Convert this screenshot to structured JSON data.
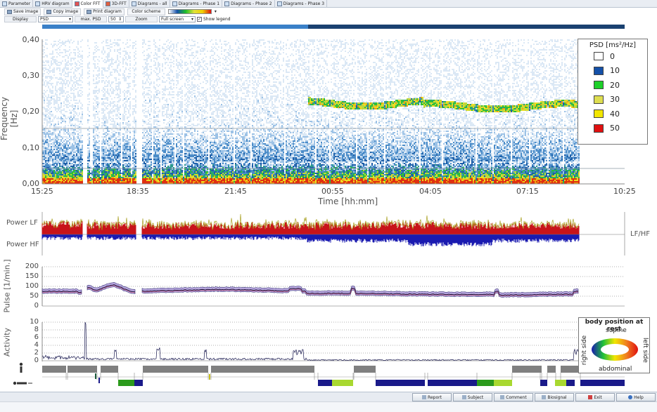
{
  "tabs": [
    {
      "label": "Parameter",
      "icon": "parameter-icon"
    },
    {
      "label": "HRV diagram",
      "icon": "hrv-icon"
    },
    {
      "label": "Color FFT",
      "icon": "color-fft-icon",
      "active": true
    },
    {
      "label": "3D-FFT",
      "icon": "3d-fft-icon"
    },
    {
      "label": "Diagrams - all",
      "icon": "diagram-icon"
    },
    {
      "label": "Diagrams - Phase 1",
      "icon": "diagram-icon"
    },
    {
      "label": "Diagrams - Phase 2",
      "icon": "diagram-icon"
    },
    {
      "label": "Diagrams - Phase 3",
      "icon": "diagram-icon"
    }
  ],
  "toolbar": {
    "save_image": "Save image",
    "copy_image": "Copy image",
    "print_diagram": "Print diagram",
    "color_scheme": "Color scheme",
    "display_label": "Display",
    "display_value": "PSD",
    "max_psd_label": "max. PSD",
    "max_psd_value": "50",
    "zoom_label": "Zoom",
    "zoom_value": "Full screen",
    "show_legend_label": "Show legend",
    "show_legend_checked": true
  },
  "spectrogram": {
    "ylabel": "Frequency [Hz]",
    "xlabel": "Time [hh:mm]",
    "yticks": [
      "0,40",
      "0,30",
      "0,20",
      "0,10",
      "0,00"
    ],
    "xticks": [
      "15:25",
      "18:35",
      "21:45",
      "00:55",
      "04:05",
      "07:15",
      "10:25"
    ],
    "legend_title": "PSD [ms²/Hz]",
    "legend": [
      {
        "label": "0",
        "color": "#ffffff"
      },
      {
        "label": "10",
        "color": "#1450a8"
      },
      {
        "label": "20",
        "color": "#1ed02a"
      },
      {
        "label": "30",
        "color": "#dede50"
      },
      {
        "label": "40",
        "color": "#f2e600"
      },
      {
        "label": "50",
        "color": "#e01010"
      }
    ]
  },
  "power": {
    "label_lf": "Power LF",
    "label_hf": "Power HF",
    "label_ratio": "LF/HF",
    "lf_color": "#c8141a",
    "hf_color": "#1a1ab0",
    "ratio_color": "#a8a020"
  },
  "pulse": {
    "ylabel": "Pulse [1/min.]",
    "yticks": [
      "200",
      "150",
      "100",
      "50",
      "0"
    ]
  },
  "activity": {
    "ylabel": "Activity",
    "yticks": [
      "10",
      "8",
      "6",
      "4",
      "2",
      "0"
    ]
  },
  "body_position": {
    "title": "body position at rest",
    "top": "supine",
    "bottom": "abdominal",
    "left": "right side",
    "right": "left side"
  },
  "bottom_buttons": [
    {
      "label": "Report",
      "icon": "report-icon"
    },
    {
      "label": "Subject",
      "icon": "subject-icon"
    },
    {
      "label": "Comment",
      "icon": "comment-icon"
    },
    {
      "label": "Biosignal",
      "icon": "biosignal-icon"
    },
    {
      "label": "Exit",
      "icon": "exit-icon"
    },
    {
      "label": "Help",
      "icon": "help-icon"
    }
  ]
}
